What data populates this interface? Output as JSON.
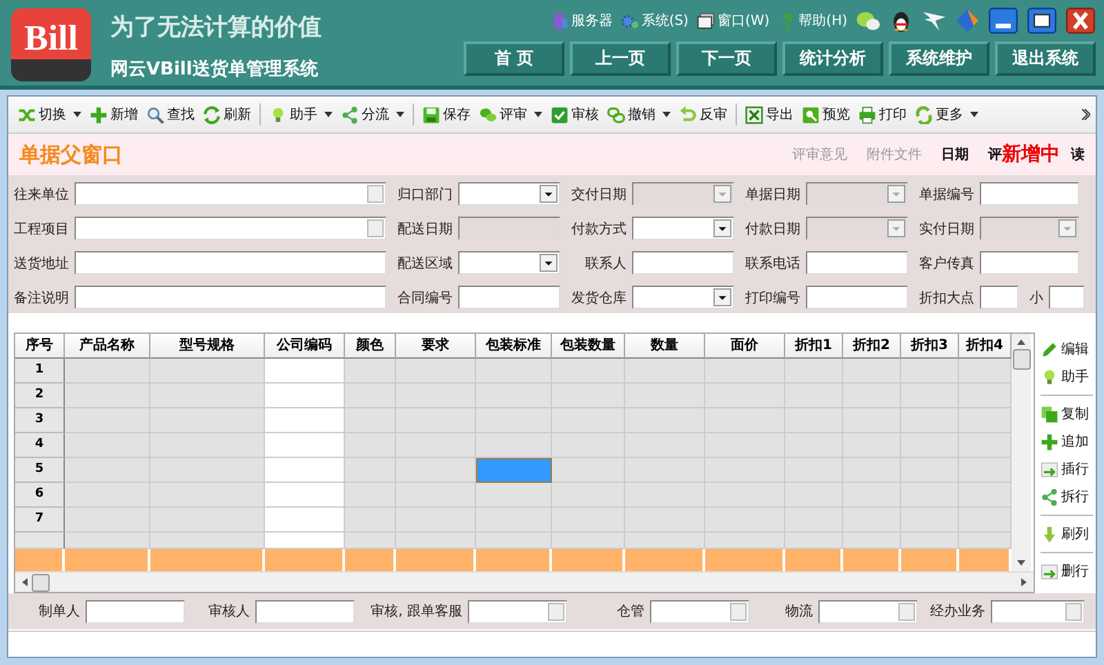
{
  "header": {
    "logo": "Bill",
    "slogan": "为了无法计算的价值",
    "title": "网云VBill送货单管理系统",
    "menu": [
      "服务器",
      "系统(S)",
      "窗口(W)",
      "帮助(H)"
    ],
    "nav": [
      "首 页",
      "上一页",
      "下一页",
      "统计分析",
      "系统维护",
      "退出系统"
    ]
  },
  "toolbar": [
    [
      {
        "label": "切换",
        "dropdown": true
      },
      {
        "label": "新增",
        "dropdown": false
      },
      {
        "label": "查找",
        "dropdown": false
      },
      {
        "label": "刷新",
        "dropdown": false
      }
    ],
    [
      {
        "label": "助手",
        "dropdown": true
      },
      {
        "label": "分流",
        "dropdown": true
      }
    ],
    [
      {
        "label": "保存",
        "dropdown": false
      },
      {
        "label": "评审",
        "dropdown": true
      },
      {
        "label": "审核",
        "dropdown": false
      },
      {
        "label": "撤销",
        "dropdown": true
      },
      {
        "label": "反审",
        "dropdown": false
      }
    ],
    [
      {
        "label": "导出",
        "dropdown": false
      },
      {
        "label": "预览",
        "dropdown": false
      },
      {
        "label": "打印",
        "dropdown": false
      },
      {
        "label": "更多",
        "dropdown": true
      }
    ]
  ],
  "title_bar": {
    "title": "单据父窗口",
    "links": [
      {
        "label": "评审意见",
        "disabled": true
      },
      {
        "label": "附件文件",
        "disabled": true
      },
      {
        "label": "日期",
        "disabled": false
      }
    ],
    "cut_label": "评",
    "status": "新增中",
    "cut_label_2": "读"
  },
  "form": [
    [
      {
        "label": "往来单位",
        "kind": "lookup",
        "disabled": false
      },
      {
        "label": "归口部门",
        "kind": "combo",
        "disabled": false
      },
      {
        "label": "交付日期",
        "kind": "combo",
        "disabled": true
      },
      {
        "label": "单据日期",
        "kind": "combo",
        "disabled": true
      },
      {
        "label": "单据编号",
        "kind": "text",
        "disabled": false
      }
    ],
    [
      {
        "label": "工程项目",
        "kind": "lookup",
        "disabled": false
      },
      {
        "label": "配送日期",
        "kind": "text",
        "disabled": true
      },
      {
        "label": "付款方式",
        "kind": "combo",
        "disabled": false
      },
      {
        "label": "付款日期",
        "kind": "combo",
        "disabled": true
      },
      {
        "label": "实付日期",
        "kind": "combo",
        "disabled": true
      }
    ],
    [
      {
        "label": "送货地址",
        "kind": "text",
        "disabled": false
      },
      {
        "label": "配送区域",
        "kind": "combo",
        "disabled": false
      },
      {
        "label": "联系人",
        "kind": "text",
        "disabled": false
      },
      {
        "label": "联系电话",
        "kind": "text",
        "disabled": false
      },
      {
        "label": "客户传真",
        "kind": "text",
        "disabled": false
      }
    ],
    [
      {
        "label": "备注说明",
        "kind": "text",
        "disabled": false
      },
      {
        "label": "合同编号",
        "kind": "text",
        "disabled": false
      },
      {
        "label": "发货仓库",
        "kind": "combo",
        "disabled": false
      },
      {
        "label": "打印编号",
        "kind": "text",
        "disabled": false
      },
      {
        "label": "折扣大点",
        "kind": "text",
        "disabled": false
      },
      {
        "label": "小",
        "kind": "text",
        "disabled": false
      }
    ]
  ],
  "grid": {
    "columns": [
      {
        "label": "序号",
        "editable": false
      },
      {
        "label": "产品名称",
        "editable": false
      },
      {
        "label": "型号规格",
        "editable": false
      },
      {
        "label": "公司编码",
        "editable": true
      },
      {
        "label": "颜色",
        "editable": false
      },
      {
        "label": "要求",
        "editable": false
      },
      {
        "label": "包装标准",
        "editable": false
      },
      {
        "label": "包装数量",
        "editable": false
      },
      {
        "label": "数量",
        "editable": false
      },
      {
        "label": "面价",
        "editable": false
      },
      {
        "label": "折扣1",
        "editable": false
      },
      {
        "label": "折扣2",
        "editable": false
      },
      {
        "label": "折扣3",
        "editable": false
      },
      {
        "label": "折扣4",
        "editable": false
      }
    ],
    "rows": [
      {
        "number": "1",
        "cells": [
          {
            "selected": false
          },
          {
            "selected": false
          },
          {
            "selected": false
          },
          {
            "selected": false
          },
          {
            "selected": false
          },
          {
            "selected": false
          },
          {
            "selected": false
          },
          {
            "selected": false
          },
          {
            "selected": false
          },
          {
            "selected": false
          },
          {
            "selected": false
          },
          {
            "selected": false
          },
          {
            "selected": false
          }
        ]
      },
      {
        "number": "2",
        "cells": [
          {
            "selected": false
          },
          {
            "selected": false
          },
          {
            "selected": false
          },
          {
            "selected": false
          },
          {
            "selected": false
          },
          {
            "selected": false
          },
          {
            "selected": false
          },
          {
            "selected": false
          },
          {
            "selected": false
          },
          {
            "selected": false
          },
          {
            "selected": false
          },
          {
            "selected": false
          },
          {
            "selected": false
          }
        ]
      },
      {
        "number": "3",
        "cells": [
          {
            "selected": false
          },
          {
            "selected": false
          },
          {
            "selected": false
          },
          {
            "selected": false
          },
          {
            "selected": false
          },
          {
            "selected": false
          },
          {
            "selected": false
          },
          {
            "selected": false
          },
          {
            "selected": false
          },
          {
            "selected": false
          },
          {
            "selected": false
          },
          {
            "selected": false
          },
          {
            "selected": false
          }
        ]
      },
      {
        "number": "4",
        "cells": [
          {
            "selected": false
          },
          {
            "selected": false
          },
          {
            "selected": false
          },
          {
            "selected": false
          },
          {
            "selected": false
          },
          {
            "selected": false
          },
          {
            "selected": false
          },
          {
            "selected": false
          },
          {
            "selected": false
          },
          {
            "selected": false
          },
          {
            "selected": false
          },
          {
            "selected": false
          },
          {
            "selected": false
          }
        ]
      },
      {
        "number": "5",
        "cells": [
          {
            "selected": false
          },
          {
            "selected": false
          },
          {
            "selected": false
          },
          {
            "selected": false
          },
          {
            "selected": false
          },
          {
            "selected": true
          },
          {
            "selected": false
          },
          {
            "selected": false
          },
          {
            "selected": false
          },
          {
            "selected": false
          },
          {
            "selected": false
          },
          {
            "selected": false
          },
          {
            "selected": false
          }
        ]
      },
      {
        "number": "6",
        "cells": [
          {
            "selected": false
          },
          {
            "selected": false
          },
          {
            "selected": false
          },
          {
            "selected": false
          },
          {
            "selected": false
          },
          {
            "selected": false
          },
          {
            "selected": false
          },
          {
            "selected": false
          },
          {
            "selected": false
          },
          {
            "selected": false
          },
          {
            "selected": false
          },
          {
            "selected": false
          },
          {
            "selected": false
          }
        ]
      },
      {
        "number": "7",
        "cells": [
          {
            "selected": false
          },
          {
            "selected": false
          },
          {
            "selected": false
          },
          {
            "selected": false
          },
          {
            "selected": false
          },
          {
            "selected": false
          },
          {
            "selected": false
          },
          {
            "selected": false
          },
          {
            "selected": false
          },
          {
            "selected": false
          },
          {
            "selected": false
          },
          {
            "selected": false
          },
          {
            "selected": false
          }
        ]
      }
    ]
  },
  "side_panel": [
    [
      "编辑",
      "助手"
    ],
    [
      "复制",
      "追加",
      "插行",
      "拆行"
    ],
    [
      "刷列"
    ],
    [
      "删行"
    ]
  ],
  "footer": [
    {
      "label": "制单人",
      "kind": "text"
    },
    {
      "label": "审核人",
      "kind": "text"
    },
    {
      "label": "审核, 跟单客服",
      "kind": "lookup"
    },
    {
      "label": "仓管",
      "kind": "lookup"
    },
    {
      "label": "物流",
      "kind": "lookup"
    },
    {
      "label": "经办业务",
      "kind": "lookup"
    }
  ]
}
